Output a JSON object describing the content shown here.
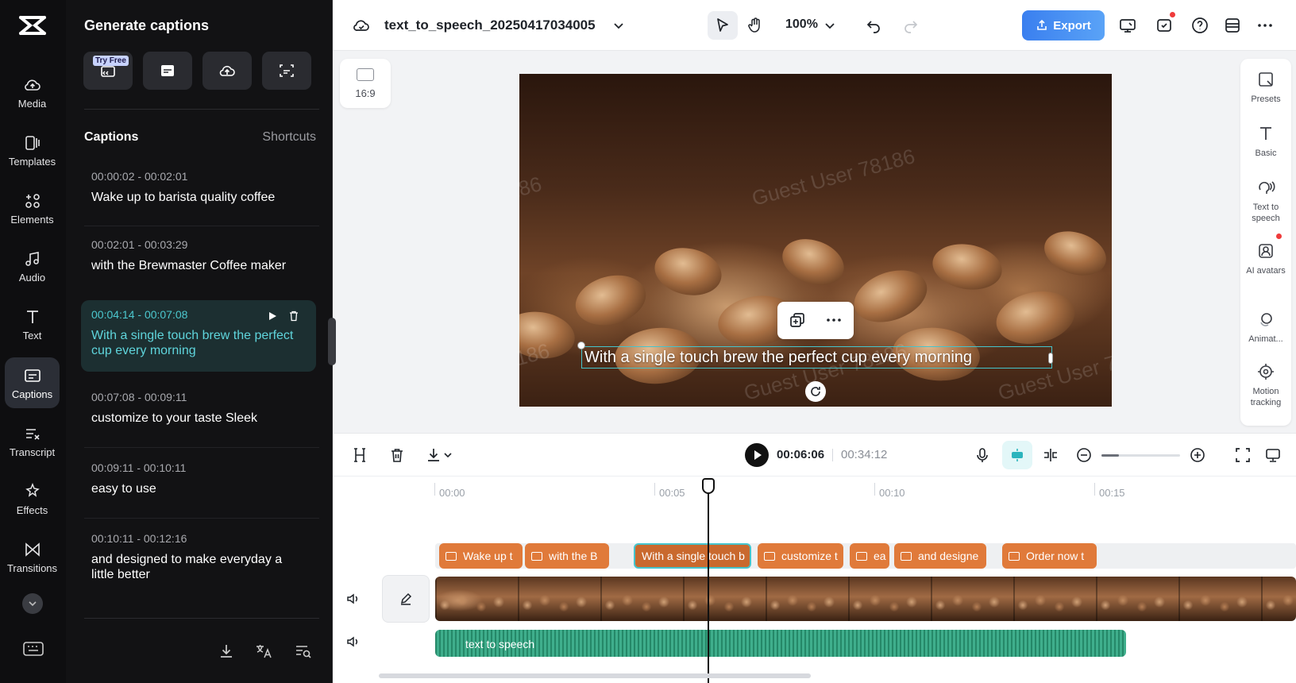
{
  "rail": {
    "items": [
      {
        "label": "Media",
        "icon": "cloud-icon"
      },
      {
        "label": "Templates",
        "icon": "templates-icon"
      },
      {
        "label": "Elements",
        "icon": "elements-icon"
      },
      {
        "label": "Audio",
        "icon": "music-note-icon"
      },
      {
        "label": "Text",
        "icon": "text-icon"
      },
      {
        "label": "Captions",
        "icon": "captions-icon"
      },
      {
        "label": "Transcript",
        "icon": "transcript-icon"
      },
      {
        "label": "Effects",
        "icon": "effects-icon"
      },
      {
        "label": "Transitions",
        "icon": "transitions-icon"
      }
    ],
    "active": "Captions"
  },
  "panel": {
    "title": "Generate captions",
    "try_badge": "Try Free",
    "section_title": "Captions",
    "shortcuts": "Shortcuts",
    "captions": [
      {
        "time": "00:00:02 - 00:02:01",
        "text": "Wake up to barista quality coffee"
      },
      {
        "time": "00:02:01 - 00:03:29",
        "text": "with the Brewmaster Coffee maker"
      },
      {
        "time": "00:04:14 - 00:07:08",
        "text": "With a single touch brew the perfect cup every morning"
      },
      {
        "time": "00:07:08 - 00:09:11",
        "text": "customize to your taste Sleek"
      },
      {
        "time": "00:09:11 - 00:10:11",
        "text": "easy to use"
      },
      {
        "time": "00:10:11 - 00:12:16",
        "text": "and designed to make everyday a little better"
      }
    ],
    "active_caption": 2
  },
  "topbar": {
    "project_name": "text_to_speech_20250417034005",
    "zoom": "100%",
    "export_label": "Export"
  },
  "canvas": {
    "aspect_ratio": "16:9",
    "caption_text": "With a single touch brew the perfect cup every morning",
    "watermark": "Guest User 78186"
  },
  "right_tools": [
    {
      "label": "Presets",
      "icon": "presets-icon"
    },
    {
      "label": "Basic",
      "icon": "text-basic-icon"
    },
    {
      "label": "Text to speech",
      "icon": "text-to-speech-icon"
    },
    {
      "label": "AI avatars",
      "icon": "ai-avatar-icon"
    },
    {
      "label": "Animat...",
      "icon": "animation-icon"
    },
    {
      "label": "Motion tracking",
      "icon": "motion-tracking-icon"
    }
  ],
  "timeline": {
    "current_time": "00:06:06",
    "total_time": "00:34:12",
    "ruler": [
      "00:00",
      "00:05",
      "00:10",
      "00:15"
    ],
    "caption_clips": [
      "Wake up t",
      "with the B",
      "With a single touch b",
      "customize t",
      "ea",
      "and designe",
      "Order now t"
    ],
    "audio_label": "text to speech"
  },
  "colors": {
    "accent": "#45c4cc",
    "export": "#3a7fef",
    "clip": "#e07a3a",
    "audio": "#3fae8c"
  }
}
